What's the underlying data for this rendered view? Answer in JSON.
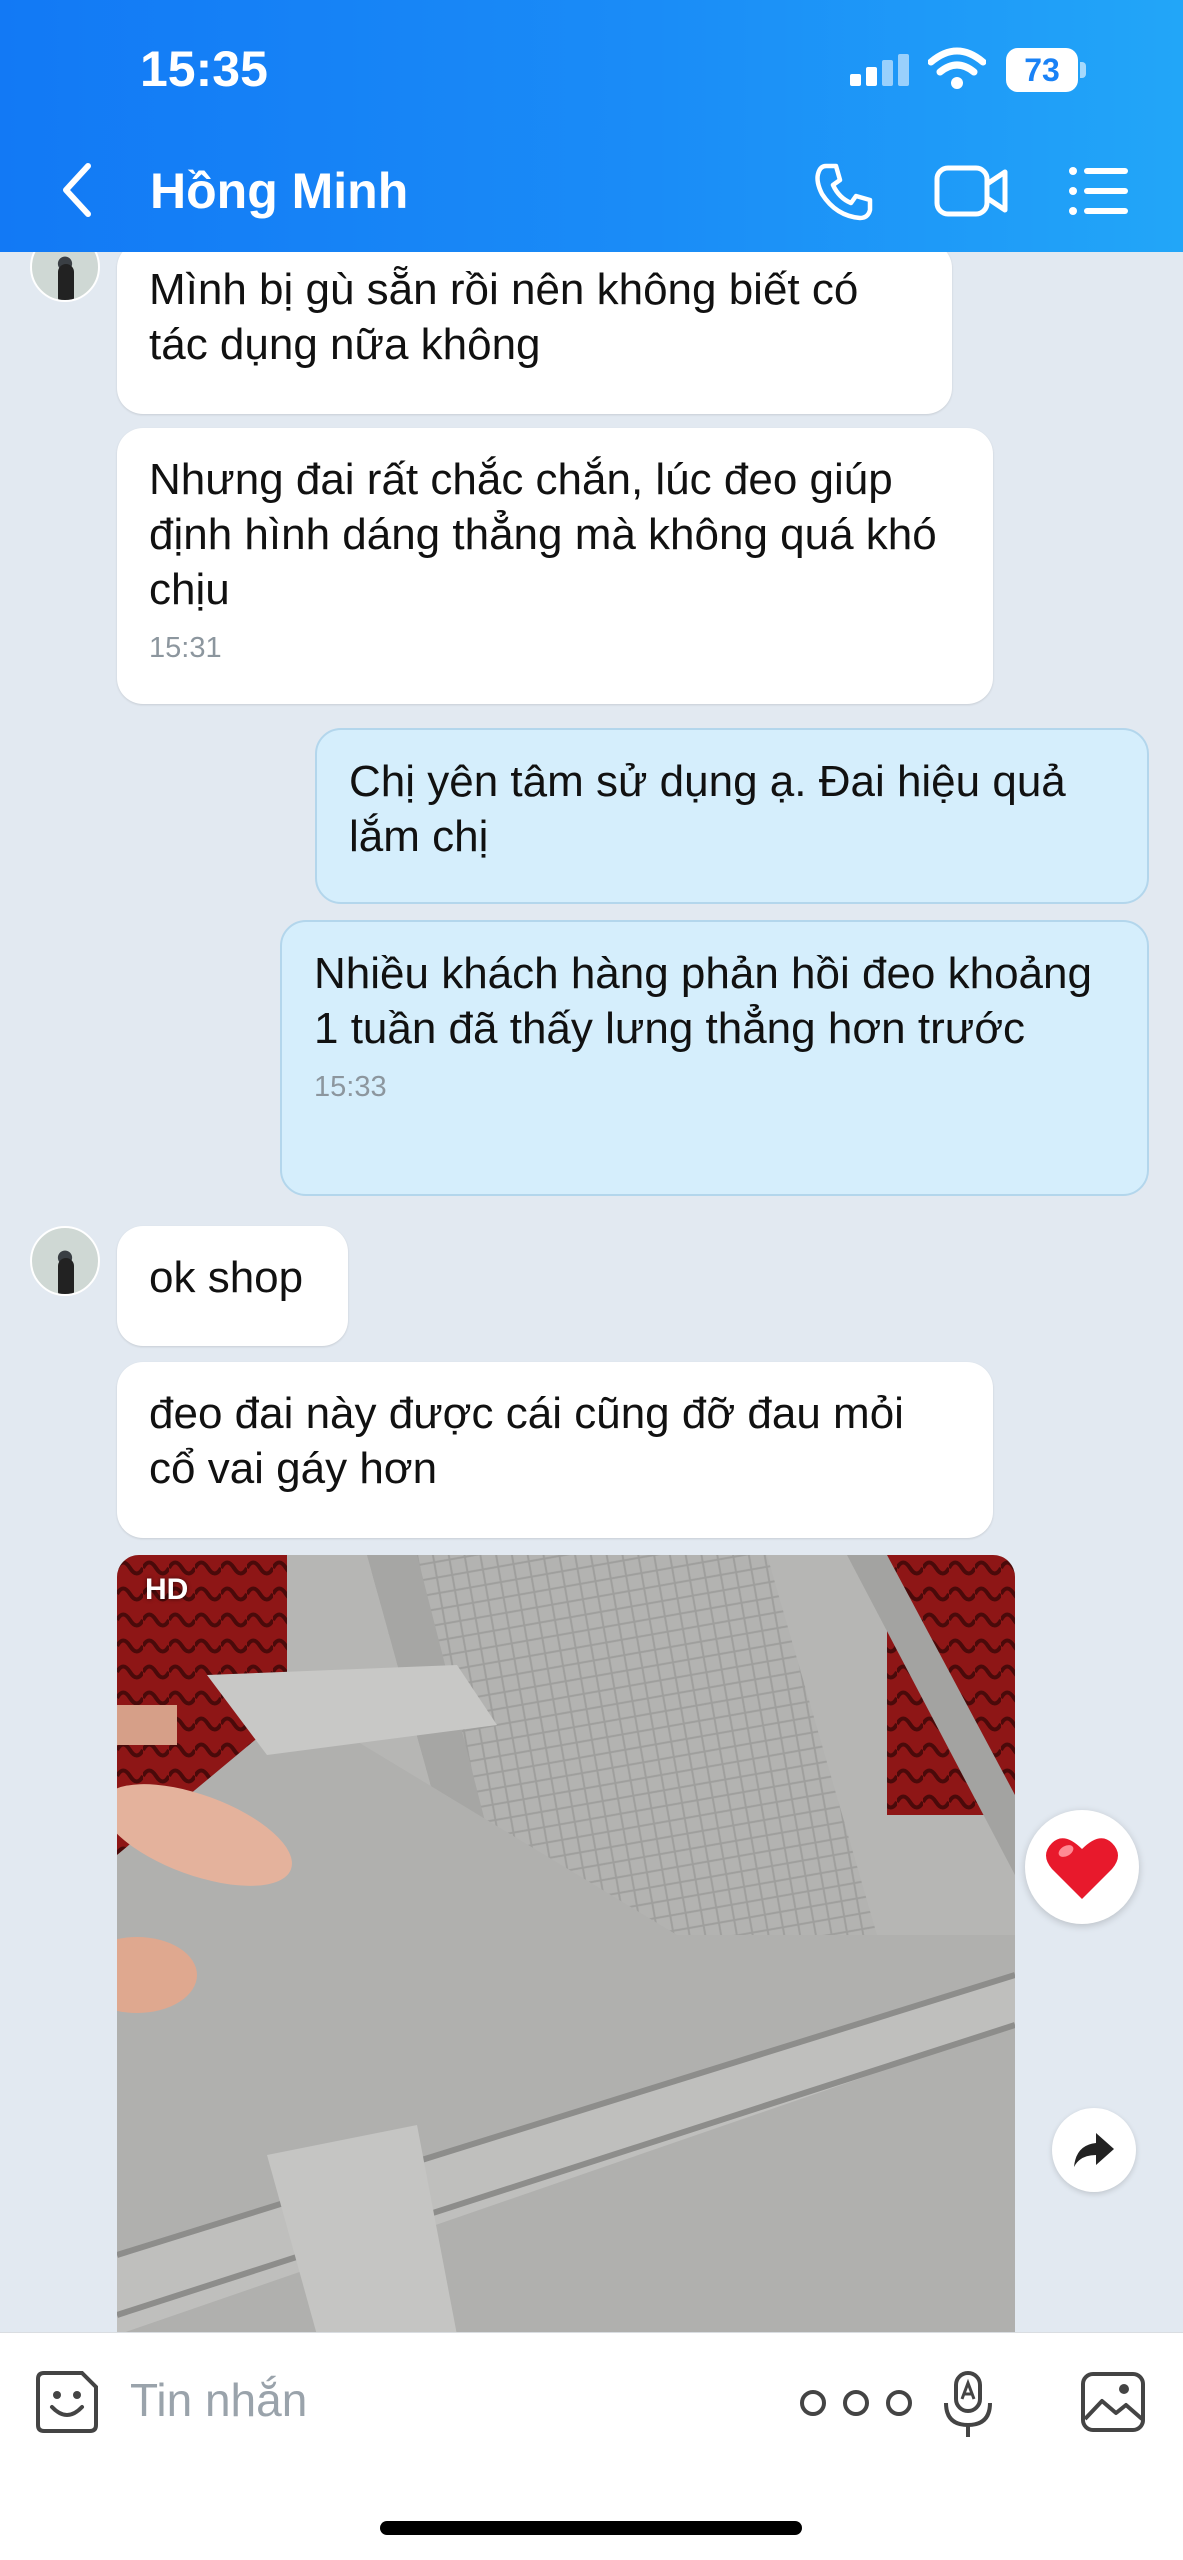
{
  "status_bar": {
    "time": "15:35",
    "battery": "73"
  },
  "header": {
    "title": "Hồng Minh"
  },
  "messages": [
    {
      "dir": "in",
      "text": "Mình bị gù sẵn rồi nên không biết có tác dụng nữa không"
    },
    {
      "dir": "in",
      "text": "Nhưng đai rất chắc chắn, lúc đeo giúp định hình dáng thẳng mà không quá khó chịu",
      "time": "15:31"
    },
    {
      "dir": "out",
      "text": "Chị yên tâm sử dụng ạ. Đai hiệu quả lắm  chị"
    },
    {
      "dir": "out",
      "text": "Nhiều khách hàng phản hồi đeo khoảng 1 tuần đã thấy lưng thẳng hơn trước",
      "time": "15:33"
    },
    {
      "dir": "in",
      "text": "ok shop"
    },
    {
      "dir": "in",
      "text": "đeo đai này được cái cũng đỡ đau mỏi cổ vai gáy hơn"
    }
  ],
  "photo": {
    "badge": "HD"
  },
  "composer": {
    "placeholder": "Tin nhắn"
  },
  "colors": {
    "header_start": "#1279f5",
    "header_end": "#22a6f8",
    "chat_bg": "#e2e9f1",
    "outgoing_bubble": "#d5eefc",
    "incoming_bubble": "#ffffff",
    "reaction_heart": "#e8192c"
  },
  "icons": [
    "back-icon",
    "phone-icon",
    "video-call-icon",
    "menu-list-icon",
    "heart-icon",
    "share-icon",
    "sticker-icon",
    "more-icon",
    "mic-icon",
    "image-icon",
    "signal-icon",
    "wifi-icon",
    "battery-icon"
  ]
}
